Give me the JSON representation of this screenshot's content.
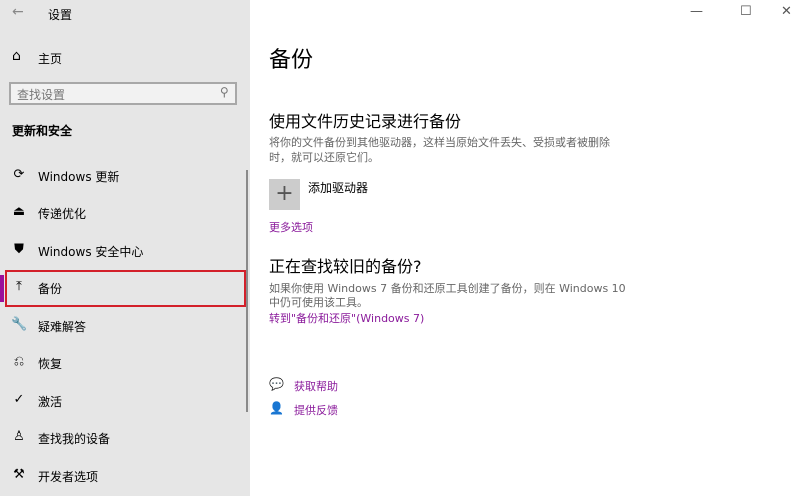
{
  "window": {
    "title": "设置",
    "back_icon": "←",
    "minimize": "—",
    "maximize": "☐",
    "close": "✕"
  },
  "sidebar": {
    "home": {
      "label": "主页",
      "icon": "⌂"
    },
    "search": {
      "placeholder": "查找设置",
      "icon": "⚲"
    },
    "section": "更新和安全",
    "items": [
      {
        "label": "Windows 更新",
        "icon": "⟳"
      },
      {
        "label": "传递优化",
        "icon": "⏏"
      },
      {
        "label": "Windows 安全中心",
        "icon": "⛊"
      },
      {
        "label": "备份",
        "icon": "⤒"
      },
      {
        "label": "疑难解答",
        "icon": "🔧"
      },
      {
        "label": "恢复",
        "icon": "⎌"
      },
      {
        "label": "激活",
        "icon": "✓"
      },
      {
        "label": "查找我的设备",
        "icon": "♙"
      },
      {
        "label": "开发者选项",
        "icon": "⚒"
      }
    ],
    "selected_index": 3
  },
  "main": {
    "title": "备份",
    "file_history": {
      "heading": "使用文件历史记录进行备份",
      "desc1": "将你的文件备份到其他驱动器，这样当原始文件丢失、受损或者被删除",
      "desc2": "时，就可以还原它们。",
      "add_icon": "+",
      "add_label": "添加驱动器",
      "more": "更多选项"
    },
    "older": {
      "heading": "正在查找较旧的备份?",
      "desc1": "如果你使用 Windows 7 备份和还原工具创建了备份，则在 Windows 10",
      "desc2": "中仍可使用该工具。",
      "link": "转到\"备份和还原\"(Windows 7)"
    },
    "help": {
      "label": "获取帮助",
      "icon": "💬"
    },
    "feedback": {
      "label": "提供反馈",
      "icon": "👤"
    }
  },
  "colors": {
    "accent": "#9b109b",
    "link": "#8a1a9b",
    "highlight": "#d3202a"
  }
}
